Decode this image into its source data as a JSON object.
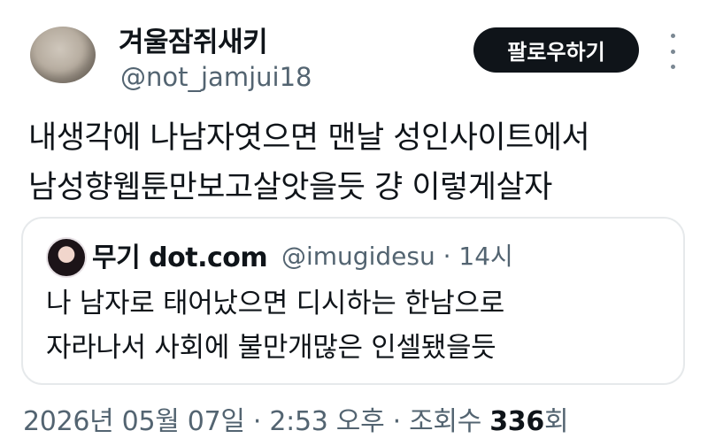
{
  "author": {
    "display_name": "겨울잠쥐새키",
    "handle": "@not_jamjui18",
    "avatar_icon": "gray-hat-avatar-icon"
  },
  "actions": {
    "follow_label": "팔로우하기",
    "more_icon": "more-vertical-icon"
  },
  "tweet": {
    "lines": [
      "내생각에 나남자엿으면 맨날 성인사이트에서",
      "남성향웹툰만보고살앗을듯 걍 이렇게살자"
    ]
  },
  "quote": {
    "display_name": "무기 dot.com",
    "handle_time": "@imugidesu · 14시",
    "avatar_icon": "anime-avatar-icon",
    "lines": [
      "나 남자로 태어났으면 디시하는 한남으로",
      "자라나서 사회에 불만개많은 인셀됐을듯"
    ]
  },
  "meta": {
    "timestamp": "2026년 05월 07일 · 2:53 오후 · 조회수 ",
    "view_count": "336",
    "view_suffix": "회"
  },
  "colors": {
    "text": "#0f1419",
    "secondary_text": "#536471",
    "button_bg": "#0f1419",
    "button_text": "#ffffff",
    "border": "#e6e9eb"
  }
}
